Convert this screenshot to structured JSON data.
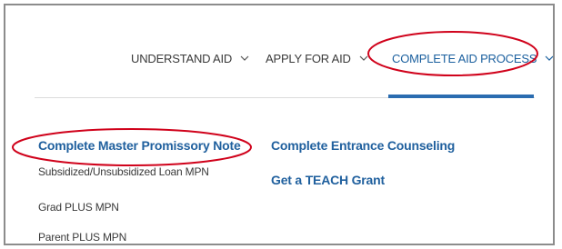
{
  "nav": {
    "items": [
      {
        "label": "UNDERSTAND AID",
        "icon": "chevron-down-icon"
      },
      {
        "label": "APPLY FOR AID",
        "icon": "chevron-down-icon"
      },
      {
        "label": "COMPLETE AID PROCESS",
        "icon": "chevron-down-icon",
        "active": true
      }
    ]
  },
  "menu": {
    "left": {
      "heading": "Complete Master Promissory Note",
      "subitems": [
        "Subsidized/Unsubsidized Loan MPN",
        "Grad PLUS MPN",
        "Parent PLUS MPN"
      ]
    },
    "right": {
      "links": [
        "Complete Entrance Counseling",
        "Get a TEACH Grant"
      ]
    }
  },
  "colors": {
    "link": "#20609e",
    "active_nav": "#1a5f9e",
    "active_bar": "#2a6cb0",
    "annotation": "#d0021b",
    "text": "#3a3a3a",
    "frame": "#8c8c8c"
  }
}
